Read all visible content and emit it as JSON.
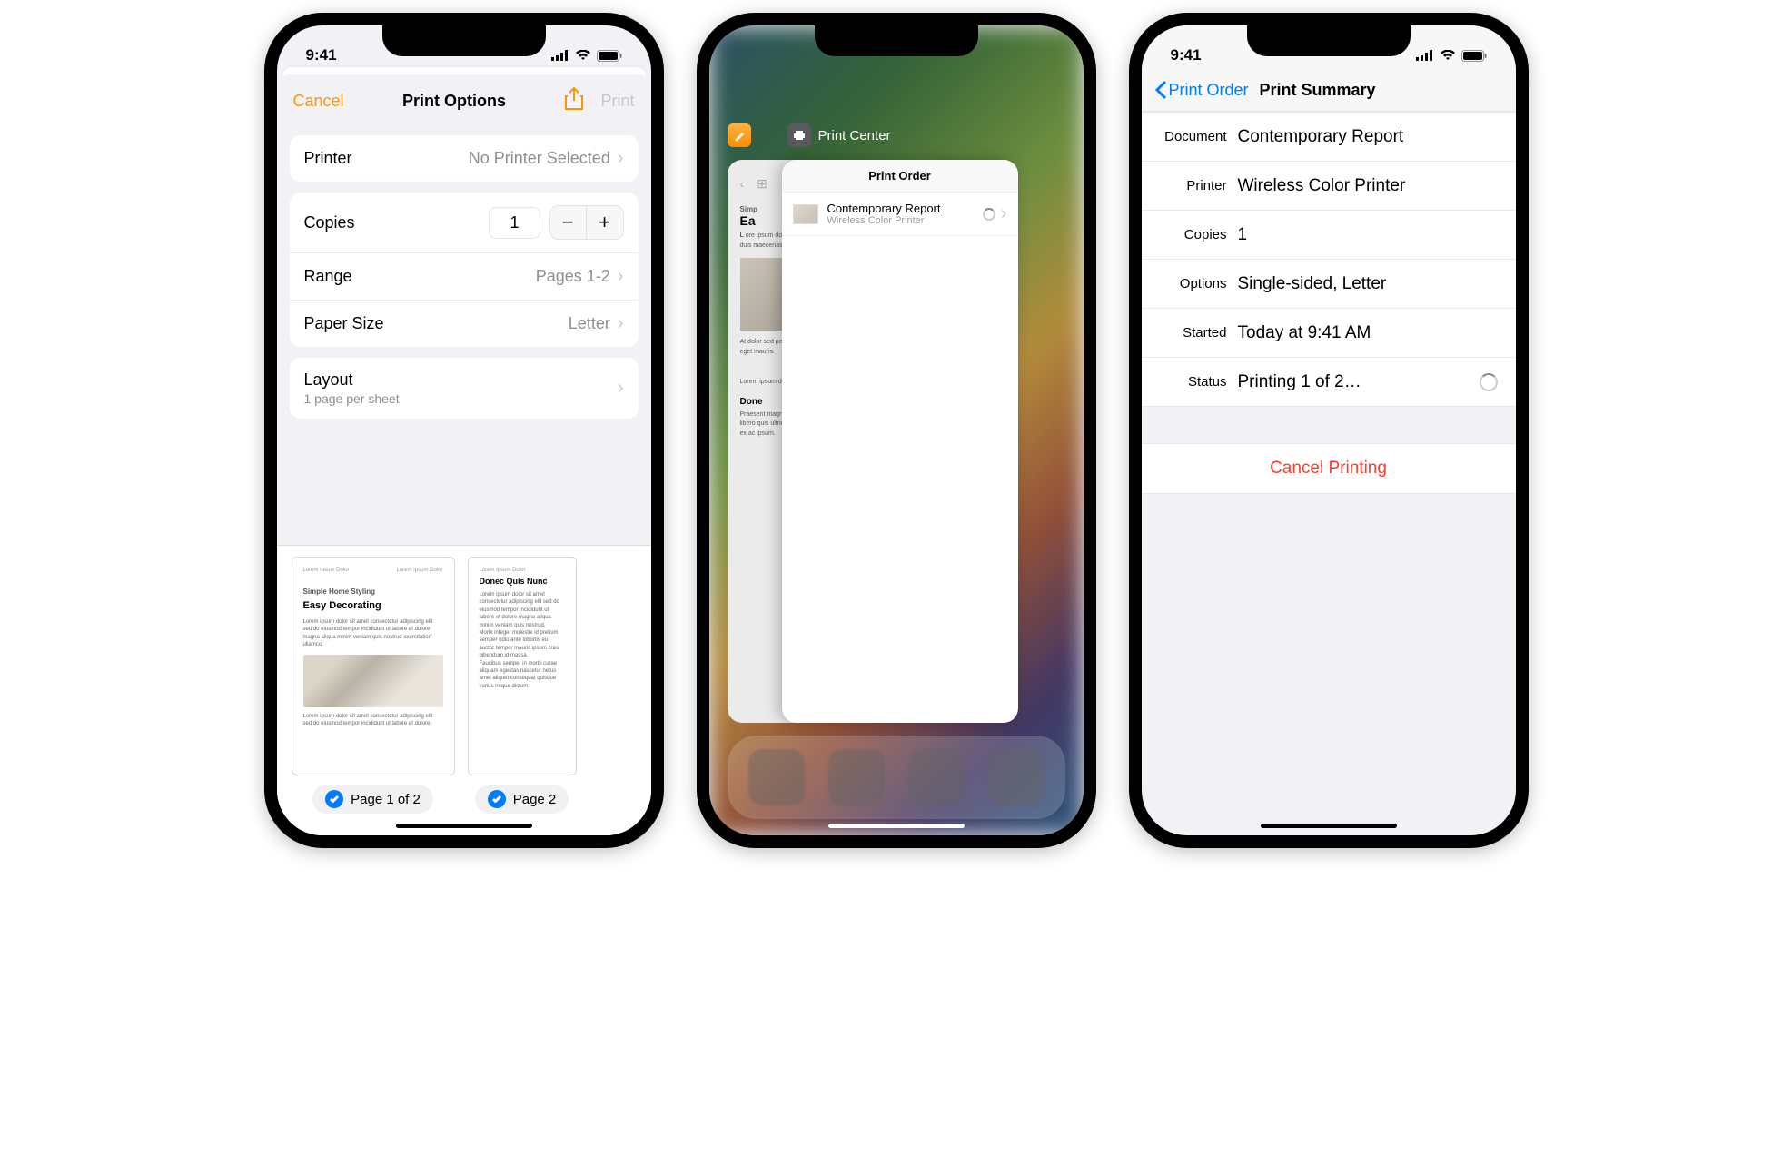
{
  "status": {
    "time": "9:41"
  },
  "phone1": {
    "nav": {
      "cancel": "Cancel",
      "title": "Print Options",
      "print": "Print"
    },
    "printer": {
      "label": "Printer",
      "value": "No Printer Selected"
    },
    "copies": {
      "label": "Copies",
      "value": "1"
    },
    "range": {
      "label": "Range",
      "value": "Pages 1-2"
    },
    "paper": {
      "label": "Paper Size",
      "value": "Letter"
    },
    "layout": {
      "label": "Layout",
      "sub": "1 page per sheet"
    },
    "preview": {
      "p1_pill": "Page 1 of 2",
      "p2_pill": "Page 2",
      "doc_subtitle": "Simple Home Styling",
      "doc_title": "Easy Decorating",
      "p2_heading": "Donec Quis Nunc"
    }
  },
  "phone2": {
    "printcenter_label": "Print Center",
    "card_title": "Print Order",
    "job_name": "Contemporary Report",
    "job_printer": "Wireless Color Printer",
    "back_subtitle": "Simp",
    "back_title": "Ea",
    "back_h2": "Done"
  },
  "phone3": {
    "back": "Print Order",
    "title": "Print Summary",
    "rows": {
      "document": {
        "k": "Document",
        "v": "Contemporary Report"
      },
      "printer": {
        "k": "Printer",
        "v": "Wireless Color Printer"
      },
      "copies": {
        "k": "Copies",
        "v": "1"
      },
      "options": {
        "k": "Options",
        "v": "Single-sided, Letter"
      },
      "started": {
        "k": "Started",
        "v": "Today at  9:41 AM"
      },
      "status": {
        "k": "Status",
        "v": "Printing 1 of 2…"
      }
    },
    "cancel": "Cancel Printing"
  }
}
